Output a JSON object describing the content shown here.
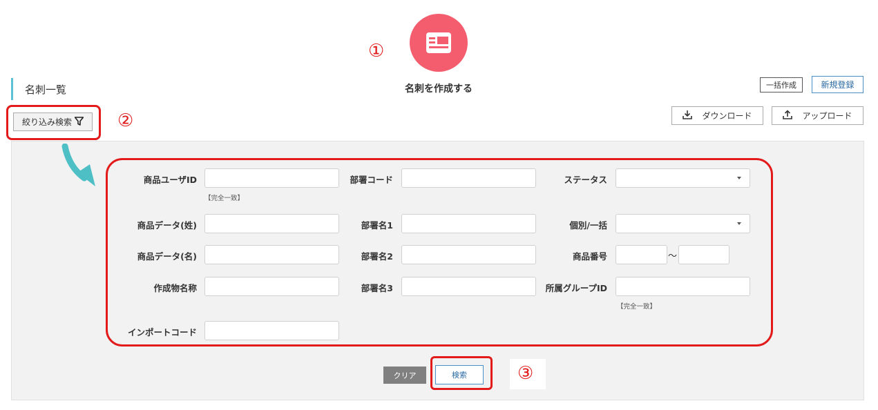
{
  "page": {
    "title": "名刺一覧",
    "create_label": "名刺を作成する",
    "create_icon": "id-card-icon"
  },
  "actions": {
    "bulk_create": "一括作成",
    "new_register": "新規登録",
    "download": "ダウンロード",
    "upload": "アップロード"
  },
  "filter": {
    "toggle_label": "絞り込み検索"
  },
  "annotations": {
    "step1": "①",
    "step2": "②",
    "step3": "③",
    "highlight_color": "#e21a1a",
    "arrow_color": "#4fbfc6"
  },
  "form": {
    "product_user_id": {
      "label": "商品ユーザID",
      "value": "",
      "note": "【完全一致】"
    },
    "dept_code": {
      "label": "部署コード",
      "value": ""
    },
    "status": {
      "label": "ステータス",
      "value": ""
    },
    "last_name": {
      "label": "商品データ(姓)",
      "value": ""
    },
    "dept_name1": {
      "label": "部署名1",
      "value": ""
    },
    "individual_bulk": {
      "label": "個別/一括",
      "value": ""
    },
    "first_name": {
      "label": "商品データ(名)",
      "value": ""
    },
    "dept_name2": {
      "label": "部署名2",
      "value": ""
    },
    "product_number": {
      "label": "商品番号",
      "from": "",
      "to": "",
      "separator": "～"
    },
    "item_name": {
      "label": "作成物名称",
      "value": ""
    },
    "dept_name3": {
      "label": "部署名3",
      "value": ""
    },
    "group_id": {
      "label": "所属グループID",
      "value": "",
      "note": "【完全一致】"
    },
    "import_code": {
      "label": "インポートコード",
      "value": ""
    }
  },
  "buttons": {
    "clear": "クリア",
    "search": "検索"
  }
}
